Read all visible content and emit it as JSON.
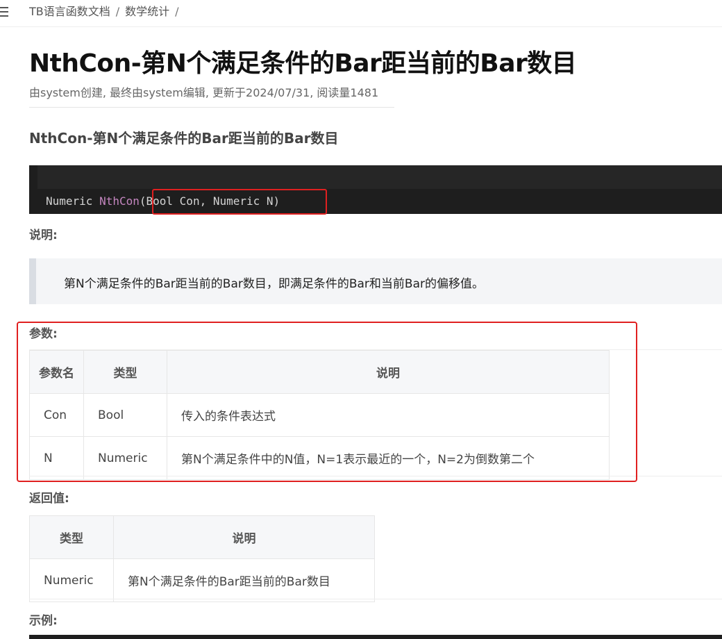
{
  "breadcrumb": {
    "root": "TB语言函数文档",
    "section": "数学统计",
    "separator": "/"
  },
  "page": {
    "title": "NthCon-第N个满足条件的Bar距当前的Bar数目",
    "meta": "由system创建, 最终由system编辑, 更新于2024/07/31, 阅读量1481",
    "subtitle": "NthCon-第N个满足条件的Bar距当前的Bar数目"
  },
  "code": {
    "return_type": "Numeric",
    "function_name": "NthCon",
    "args": "(Bool Con, Numeric N)"
  },
  "description": {
    "label": "说明:",
    "text": "第N个满足条件的Bar距当前的Bar数目，即满足条件的Bar和当前Bar的偏移值。"
  },
  "params": {
    "label": "参数:",
    "headers": [
      "参数名",
      "类型",
      "说明"
    ],
    "rows": [
      [
        "Con",
        "Bool",
        "传入的条件表达式"
      ],
      [
        "N",
        "Numeric",
        "第N个满足条件中的N值，N=1表示最近的一个，N=2为倒数第二个"
      ]
    ]
  },
  "returns": {
    "label": "返回值:",
    "headers": [
      "类型",
      "说明"
    ],
    "rows": [
      [
        "Numeric",
        "第N个满足条件的Bar距当前的Bar数目"
      ]
    ]
  },
  "example": {
    "label": "示例:"
  },
  "colors": {
    "highlight": "#e02020",
    "code_bg": "#1e1e1e",
    "fn_color": "#c586c0"
  },
  "icons": {
    "menu": "hamburger-menu-icon"
  }
}
